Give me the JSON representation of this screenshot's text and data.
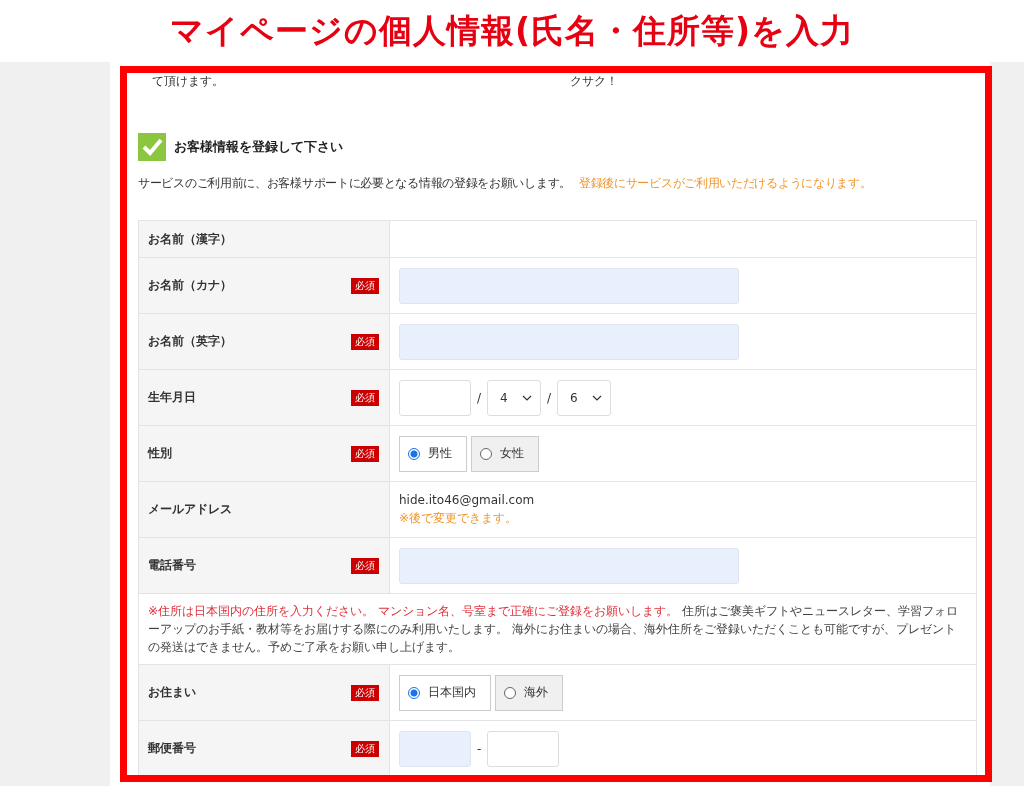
{
  "banner": {
    "title": "マイページの個人情報(氏名・住所等)を入力"
  },
  "top_texts": [
    "て頂けます。",
    "クサク！"
  ],
  "section": {
    "title": "お客様情報を登録して下さい",
    "intro": "サービスのご利用前に、お客様サポートに必要となる情報の登録をお願いします。",
    "intro_notice": "登録後にサービスがご利用いただけるようになります。"
  },
  "rows": [
    {
      "kind": "empty",
      "label": "お名前（漢字）"
    },
    {
      "kind": "input",
      "label": "お名前（カナ）",
      "required_tag": "必須"
    },
    {
      "kind": "input",
      "label": "お名前（英字）",
      "required_tag": "必須"
    },
    {
      "kind": "date",
      "label": "生年月日",
      "required_tag": "必須",
      "separator": "/",
      "month": "4",
      "day": "6"
    },
    {
      "kind": "radio",
      "label": "性別",
      "required_tag": "必須",
      "options": [
        {
          "label": "男性",
          "selected": true
        },
        {
          "label": "女性",
          "selected": false
        }
      ]
    },
    {
      "kind": "static",
      "label": "メールアドレス",
      "value": "hide.ito46@gmail.com",
      "hint": "※後で変更できます。"
    },
    {
      "kind": "input",
      "label": "電話番号",
      "required_tag": "必須"
    },
    {
      "kind": "note",
      "warning": "※住所は日本国内の住所を入力ください。 マンション名、号室まで正確にご登録をお願いします。",
      "text": "住所はご褒美ギフトやニュースレター、学習フォローアップのお手紙・教材等をお届けする際にのみ利用いたします。 海外にお住まいの場合、海外住所をご登録いただくことも可能ですが、プレゼントの発送はできません。予めご了承をお願い申し上げます。"
    },
    {
      "kind": "radio",
      "label": "お住まい",
      "required_tag": "必須",
      "options": [
        {
          "label": "日本国内",
          "selected": true
        },
        {
          "label": "海外",
          "selected": false
        }
      ]
    },
    {
      "kind": "postal",
      "label": "郵便番号",
      "required_tag": "必須",
      "separator": "-"
    }
  ]
}
